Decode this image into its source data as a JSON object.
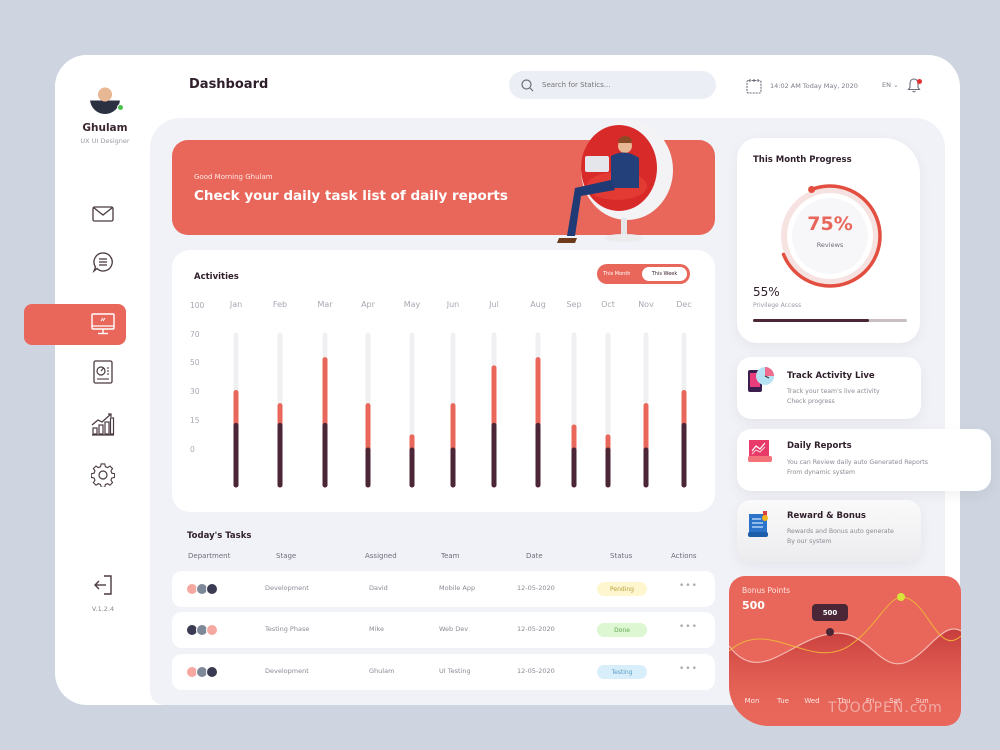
{
  "user": {
    "name": "Ghulam",
    "role": "UX UI Designer",
    "status": "online"
  },
  "sidebar": {
    "items": [
      {
        "icon": "mail-icon",
        "label": "Mail"
      },
      {
        "icon": "chat-icon",
        "label": "Messages"
      },
      {
        "icon": "monitor-icon",
        "label": "Dashboard",
        "active": true
      },
      {
        "icon": "report-icon",
        "label": "Reports"
      },
      {
        "icon": "growth-chart-icon",
        "label": "Analytics"
      },
      {
        "icon": "gear-icon",
        "label": "Settings"
      }
    ],
    "logout_icon": "logout-icon",
    "version": "V.1.2.4"
  },
  "header": {
    "title": "Dashboard",
    "search_placeholder": "Search for Statics...",
    "datetime": "14:02 AM Today May, 2020",
    "language": "EN",
    "has_notification": true
  },
  "hero": {
    "greeting": "Good Morning Ghulam",
    "title": "Check your daily task list of daily reports"
  },
  "activities": {
    "title": "Activities",
    "toggle": {
      "options": [
        "This Month",
        "This Week"
      ],
      "selected": "This Week"
    }
  },
  "chart_data": {
    "type": "bar",
    "title": "Activities",
    "categories": [
      "Jan",
      "Feb",
      "Mar",
      "Apr",
      "May",
      "Jun",
      "Jul",
      "Aug",
      "Sep",
      "Oct",
      "Nov",
      "Dec"
    ],
    "ytick_labels": [
      "100",
      "70",
      "50",
      "30",
      "15",
      "0"
    ],
    "series": [
      {
        "name": "base",
        "color": "#4a2636",
        "values": [
          15,
          15,
          15,
          0,
          0,
          0,
          15,
          15,
          0,
          0,
          0,
          15
        ]
      },
      {
        "name": "total",
        "color": "#e8675a",
        "values": [
          35,
          27,
          55,
          27,
          8,
          27,
          50,
          55,
          14,
          8,
          27,
          35
        ]
      }
    ],
    "track_color": "#f0f0f3",
    "ylim": [
      -25,
      70
    ],
    "stacked": false,
    "grid": false
  },
  "tasks": {
    "title": "Today's Tasks",
    "columns": [
      "Department",
      "Stage",
      "Assigned",
      "Team",
      "Date",
      "Status",
      "Actions"
    ],
    "rows": [
      {
        "stage": "Development",
        "assigned": "David",
        "team": "Mobile App",
        "date": "12-05-2020",
        "status": "Pending",
        "status_bg": "#fdf6cf",
        "status_fg": "#b9a13c",
        "actions": "•••"
      },
      {
        "stage": "Testing Phase",
        "assigned": "Mike",
        "team": "Web Dev",
        "date": "12-05-2020",
        "status": "Done",
        "status_bg": "#dcf7d2",
        "status_fg": "#66a657",
        "actions": "•••"
      },
      {
        "stage": "Development",
        "assigned": "Ghulam",
        "team": "UI Testing",
        "date": "12-05-2020",
        "status": "Testing",
        "status_bg": "#d8effb",
        "status_fg": "#5a9cc2",
        "actions": "•••"
      }
    ]
  },
  "progress": {
    "title": "This Month Progress",
    "reviews_pct": 75,
    "reviews_label": "75%",
    "reviews_caption": "Reviews",
    "privilege_pct": 75,
    "privilege_label": "55%",
    "privilege_caption": "Privilege Access"
  },
  "features": [
    {
      "icon": "track-activity-icon",
      "title": "Track Activity Live",
      "desc1": "Track your team's live activity",
      "desc2": "Check progress"
    },
    {
      "icon": "daily-reports-icon",
      "title": "Daily Reports",
      "desc1": "You can Review daily auto Generated Reports",
      "desc2": "From dynamic system"
    },
    {
      "icon": "reward-icon",
      "title": "Reward & Bonus",
      "desc1": "Rewards and Bonus auto generate",
      "desc2": "By our system"
    }
  ],
  "bonus": {
    "title": "Bonus Points",
    "value": "500",
    "tooltip": "500",
    "days": [
      "Mon",
      "Tue",
      "Wed",
      "Thu",
      "Fri",
      "Sat",
      "Sun"
    ]
  },
  "watermark": "TOOOPEN.com",
  "colors": {
    "accent": "#e8675a",
    "dark": "#4a2636",
    "bg": "#cfd5e0"
  }
}
